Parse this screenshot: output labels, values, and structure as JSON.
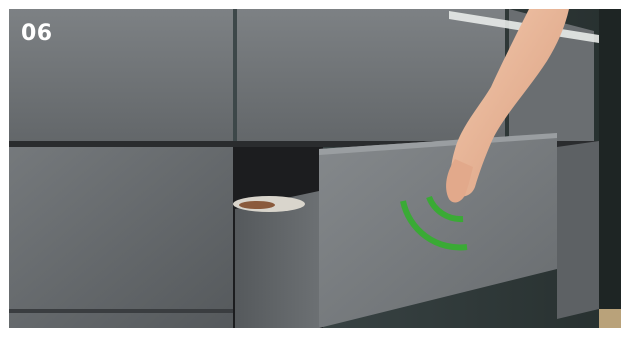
{
  "step_number": "06",
  "colors": {
    "cabinet": "#6f7376",
    "cabinet_dark": "#4a4d50",
    "drawer_front": "#7b7f82",
    "interior": "#1f2022",
    "wall": "#3b4447",
    "skin": "#e9b79a",
    "signal": "#3aaa35"
  },
  "icons": {
    "signal": "touch-signal-arcs-icon"
  }
}
